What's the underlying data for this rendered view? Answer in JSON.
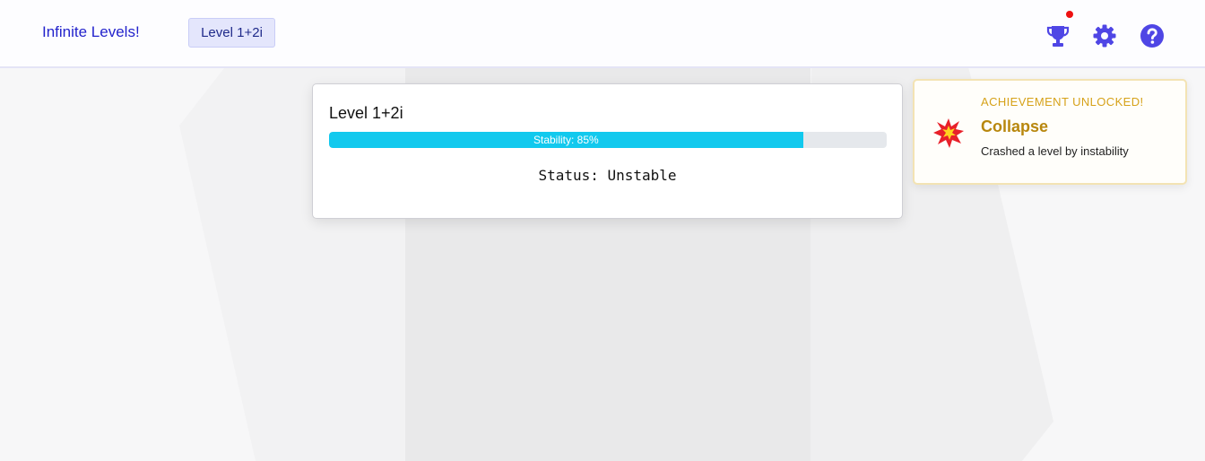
{
  "header": {
    "brand": "Infinite Levels!",
    "level_chip": "Level 1+2i",
    "icons": [
      "trophy-icon",
      "gear-icon",
      "help-icon"
    ],
    "accent_color": "#4f46e5",
    "has_notification": true
  },
  "level_card": {
    "title": "Level 1+2i",
    "stability_label": "Stability: 85%",
    "stability_fraction": 0.85,
    "status": "Status: Unstable",
    "bar_color": "#12c9ee"
  },
  "achievement": {
    "kicker": "ACHIEVEMENT UNLOCKED!",
    "name": "Collapse",
    "description": "Crashed a level by instability",
    "icon": "collision-icon"
  }
}
